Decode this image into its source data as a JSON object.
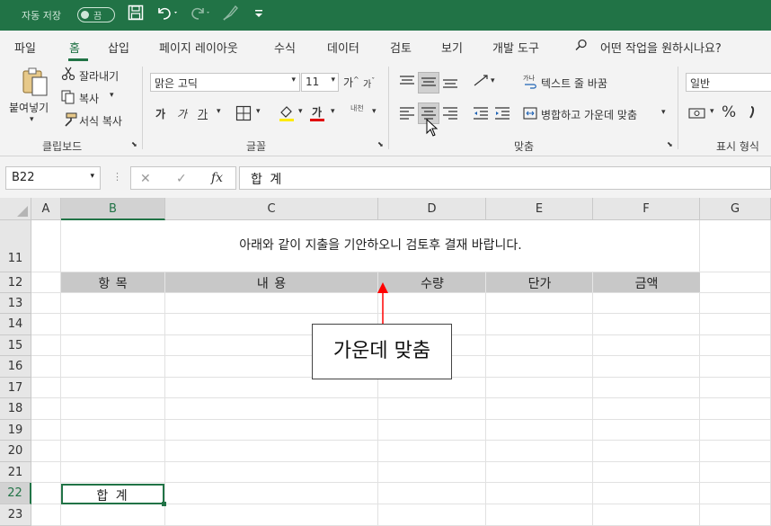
{
  "titlebar": {
    "autosave_label": "자동 저장",
    "autosave_state": "끔",
    "qat_save_icon": "save-icon",
    "qat_undo_icon": "undo-icon",
    "qat_redo_icon": "redo-icon",
    "qat_brush_icon": "brush-icon",
    "qat_customize_icon": "customize-icon"
  },
  "menu": {
    "items": [
      "파일",
      "홈",
      "삽입",
      "페이지 레이아웃",
      "수식",
      "데이터",
      "검토",
      "보기",
      "개발 도구"
    ],
    "active": "홈",
    "search_placeholder": "어떤 작업을 원하시나요?"
  },
  "ribbon": {
    "clipboard": {
      "paste": "붙여넣기",
      "cut": "잘라내기",
      "copy": "복사",
      "format_painter": "서식 복사",
      "label": "클립보드"
    },
    "font": {
      "name": "맑은 고딕",
      "size": "11",
      "bold": "가",
      "italic": "가",
      "underline": "가",
      "grow": "가",
      "shrink": "가",
      "font_color": "가",
      "phonetic": "내천",
      "label": "글꼴"
    },
    "alignment": {
      "wrap_text": "텍스트 줄 바꿈",
      "merge_center": "병합하고 가운데 맞춤",
      "label": "맞춤"
    },
    "number": {
      "format": "일반",
      "percent": "%",
      "label": "표시 형식"
    }
  },
  "formula_bar": {
    "name_box": "B22",
    "fx": "fx",
    "content": "합 계"
  },
  "grid": {
    "columns": [
      "A",
      "B",
      "C",
      "D",
      "E",
      "F",
      "G"
    ],
    "selected_column": "B",
    "rows": [
      "11",
      "12",
      "13",
      "14",
      "15",
      "16",
      "17",
      "18",
      "19",
      "20",
      "21",
      "22",
      "23"
    ],
    "selected_row": "22",
    "title_text": "아래와 같이 지출을 기안하오니 검토후 결재 바랍니다.",
    "headers": [
      "항 목",
      "내 용",
      "수량",
      "단가",
      "금액"
    ],
    "total_cell": "합 계"
  },
  "callout": {
    "text": "가운데 맞춤"
  },
  "colors": {
    "accent": "#217346",
    "header_band": "#c8c8c8",
    "arrow": "#ff0000"
  }
}
